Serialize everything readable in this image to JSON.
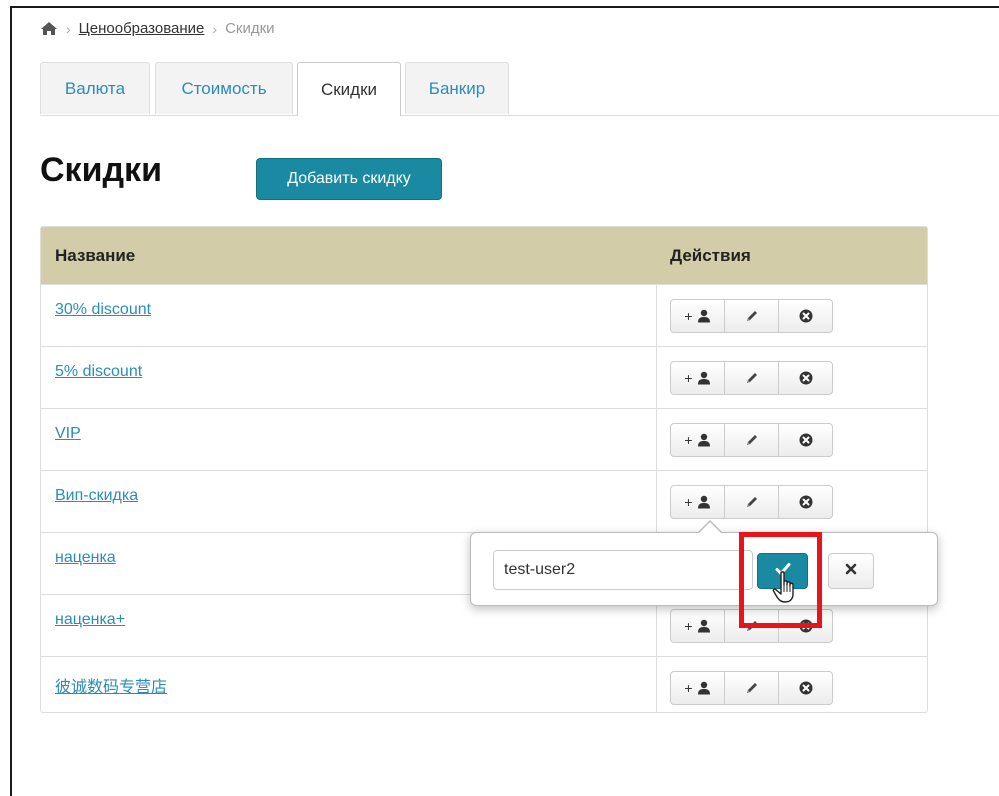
{
  "breadcrumb": {
    "home_icon": "home-icon",
    "separator": "›",
    "parent": "Ценообразование",
    "current": "Скидки"
  },
  "tabs": [
    {
      "label": "Валюта",
      "active": false
    },
    {
      "label": "Стоимость",
      "active": false
    },
    {
      "label": "Скидки",
      "active": true
    },
    {
      "label": "Банкир",
      "active": false
    }
  ],
  "page": {
    "title": "Скидки",
    "add_button_label": "Добавить скидку"
  },
  "table": {
    "headers": {
      "name": "Название",
      "actions": "Действия"
    },
    "rows": [
      {
        "name": "30% discount"
      },
      {
        "name": "5% discount"
      },
      {
        "name": "VIP"
      },
      {
        "name": "Вип-скидка"
      },
      {
        "name": "наценка"
      },
      {
        "name": "наценка+"
      },
      {
        "name": "彼诚数码专营店"
      }
    ],
    "action_buttons": {
      "add_user_label": "+",
      "add_user_icon": "user-icon",
      "edit_icon": "pencil-icon",
      "delete_icon": "remove-circle-icon"
    }
  },
  "popover": {
    "input_value": "test-user2",
    "confirm_icon": "checkmark-icon",
    "cancel_icon": "close-icon"
  },
  "colors": {
    "accent": "#1a8aa3",
    "link": "#2a8db8",
    "table_header": "#d2cca9",
    "highlight": "#e8141c"
  }
}
